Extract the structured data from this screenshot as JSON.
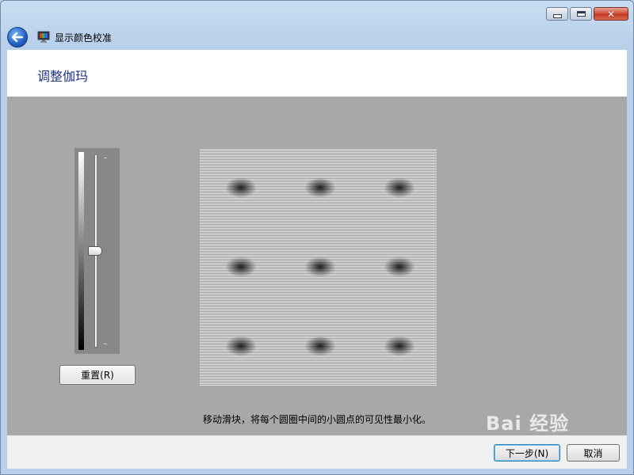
{
  "window": {
    "title": "显示颜色校准",
    "caption_buttons": [
      "minimize",
      "maximize",
      "close"
    ],
    "close_glyph": "✕"
  },
  "page": {
    "heading": "调整伽玛",
    "instruction": "移动滑块，将每个圆圈中间的小圆点的可见性最小化。"
  },
  "gamma_slider": {
    "level": 0.5
  },
  "buttons": {
    "reset": "重置(R)",
    "next": "下一步(N)",
    "cancel": "取消"
  },
  "watermark": "Bai 经验",
  "icons": {
    "back": "back-arrow-icon",
    "app": "display-calibration-icon"
  }
}
